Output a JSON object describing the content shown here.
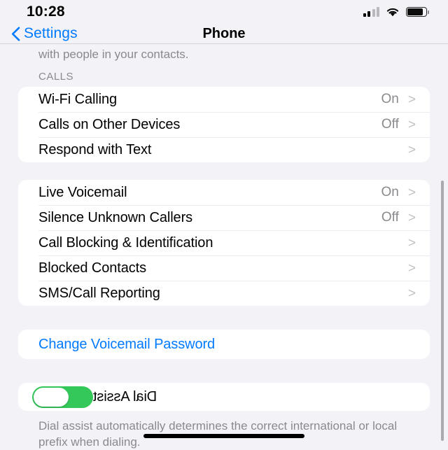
{
  "status_bar": {
    "time": "10:28",
    "signal_icon": "cellular-signal-icon",
    "signal_bars_filled": 2,
    "signal_bars_total": 4,
    "wifi_icon": "wifi-icon",
    "battery_icon": "battery-icon",
    "battery_level_percent": 85
  },
  "nav": {
    "back_icon": "chevron-left-icon",
    "back_label": "Settings",
    "title": "Phone"
  },
  "top_footer": {
    "text": "with people in your contacts."
  },
  "sections": [
    {
      "header": "CALLS",
      "rows": [
        {
          "label": "Wi-Fi Calling",
          "value": "On",
          "chevron": ">"
        },
        {
          "label": "Calls on Other Devices",
          "value": "Off",
          "chevron": ">"
        },
        {
          "label": "Respond with Text",
          "value": "",
          "chevron": ">"
        }
      ]
    },
    {
      "header": "",
      "rows": [
        {
          "label": "Live Voicemail",
          "value": "On",
          "chevron": ">"
        },
        {
          "label": "Silence Unknown Callers",
          "value": "Off",
          "chevron": ">"
        },
        {
          "label": "Call Blocking & Identification",
          "value": "",
          "chevron": ">"
        },
        {
          "label": "Blocked Contacts",
          "value": "",
          "chevron": ">"
        },
        {
          "label": "SMS/Call Reporting",
          "value": "",
          "chevron": ">"
        }
      ]
    }
  ],
  "voicemail_link": {
    "label": "Change Voicemail Password"
  },
  "dial_assist": {
    "label": "Dial Assist",
    "state": "on",
    "mirrored": true,
    "footer": "Dial assist automatically determines the correct international or local prefix when dialing."
  },
  "colors": {
    "accent_blue": "#007aff",
    "toggle_green": "#34c759",
    "background": "#f2f2f7",
    "card": "#ffffff",
    "secondary_text": "#8a8a8e"
  },
  "home_indicator": "home-indicator"
}
